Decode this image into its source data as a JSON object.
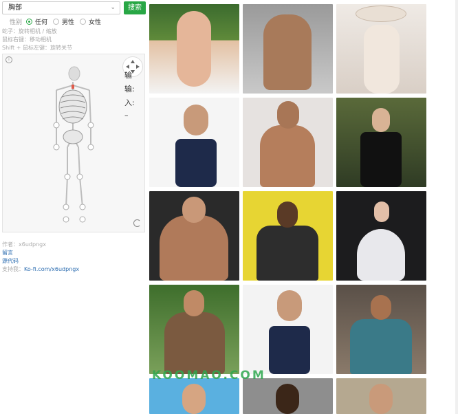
{
  "search": {
    "selected": "胸部",
    "button_label": "搜索"
  },
  "gender": {
    "label": "性别",
    "options": [
      "任何",
      "男性",
      "女性"
    ],
    "selected_index": 0
  },
  "hints": [
    "蛇子：旋转相机 / 缩放",
    "鼠标右键：移动相机",
    "Shift + 鼠标左键：旋转关节"
  ],
  "side_controls": [
    "输",
    "输:",
    "入:",
    "–"
  ],
  "footer": {
    "author_label": "作者：x6udpngx",
    "feedback": "留言",
    "source": "源代码",
    "support_label": "支持我：",
    "support_link": "Ko-fi.com/x6udpngx"
  },
  "watermark": "KOOMAO.COM",
  "accent_color": "#28a745",
  "icons": [
    "chevron-down-icon",
    "info-icon",
    "dpad-icon",
    "reload-icon"
  ]
}
